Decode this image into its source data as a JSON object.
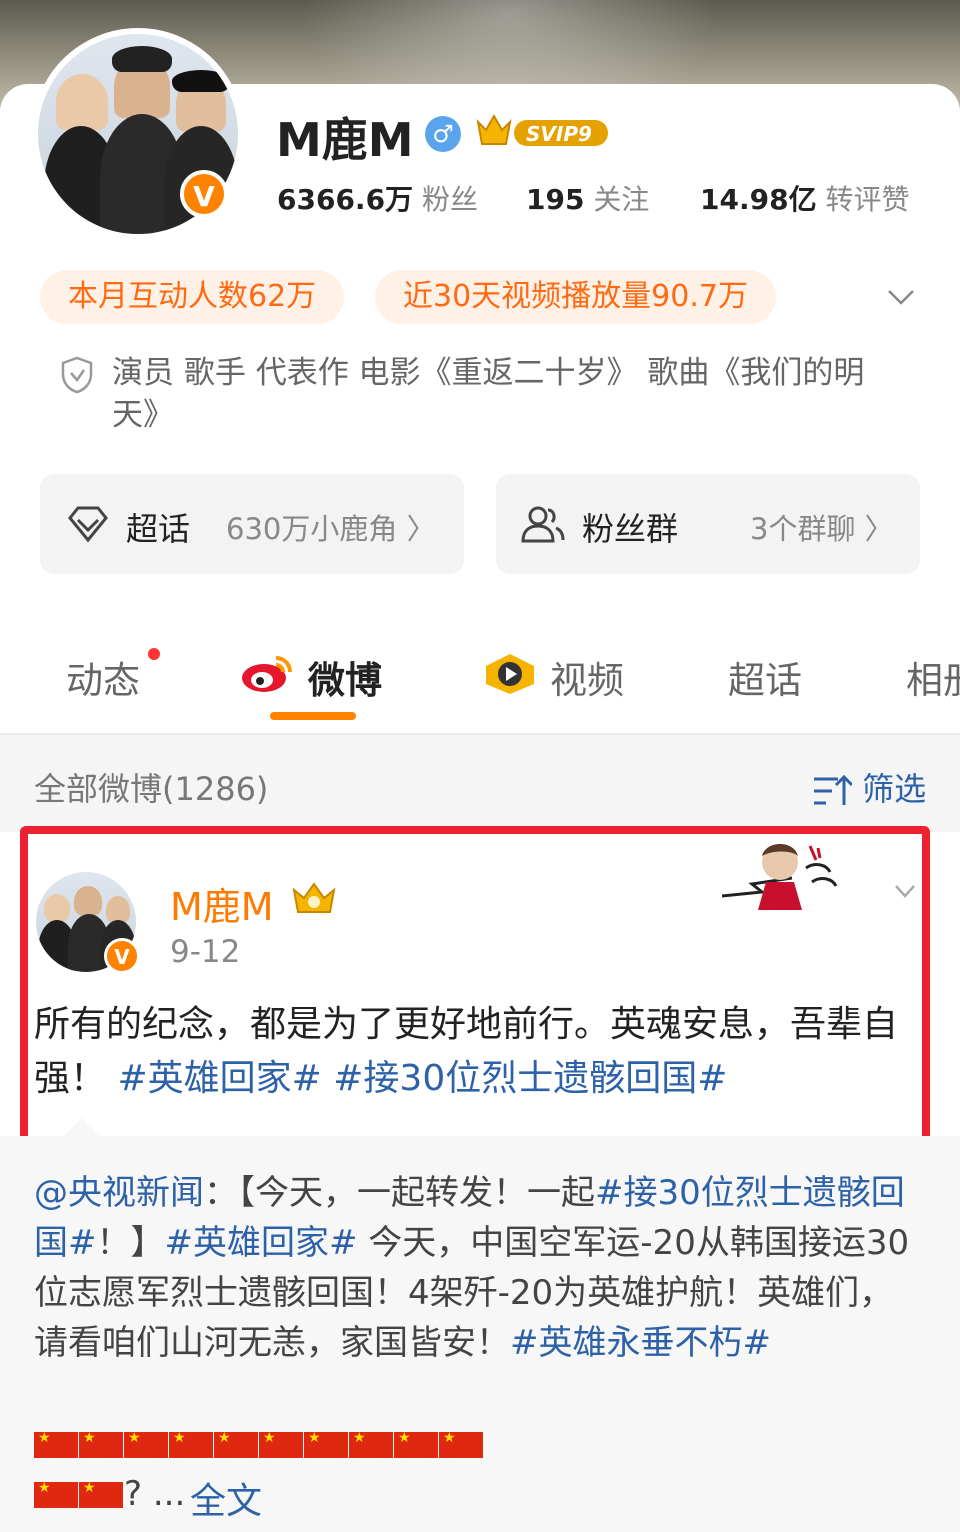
{
  "profile": {
    "name": "M鹿M",
    "gender_icon": "♂",
    "vip_badge": "SVIP9",
    "verified_badge": "V",
    "stats": {
      "fans_value": "6366.6万",
      "fans_label": "粉丝",
      "following_value": "195",
      "following_label": "关注",
      "interactions_value": "14.98亿",
      "interactions_label": "转评赞"
    },
    "pills": [
      "本月互动人数62万",
      "近30天视频播放量90.7万"
    ],
    "bio": "演员 歌手 代表作 电影《重返二十岁》 歌曲《我们的明天》"
  },
  "cards": {
    "supertopic": {
      "label": "超话",
      "value": "630万小鹿角 〉"
    },
    "fangroup": {
      "label": "粉丝群",
      "value": "3个群聊 〉"
    }
  },
  "tabs": [
    "动态",
    "微博",
    "视频",
    "超话",
    "相册"
  ],
  "feed": {
    "all_label": "全部微博(1286)",
    "filter_label": "筛选"
  },
  "post": {
    "author": "M鹿M",
    "date": "9-12",
    "text_plain": "所有的纪念，都是为了更好地前行。英魂安息，吾辈自强！",
    "topic1": "#英雄回家#",
    "topic2": "#接30位烈士遗骸回国#",
    "repost": {
      "mention": "@央视新闻",
      "part1": "：【今天，一起转发！一起",
      "topic_a": "#接30位烈士遗骸回国#",
      "part2": "！】",
      "topic_b": "#英雄回家#",
      "part3": " 今天，中国空军运-20从韩国接运30位志愿军烈士遗骸回国！4架歼-20为英雄护航！英雄们，请看咱们山河无恙，家国皆安！",
      "topic_c": "#英雄永垂不朽#",
      "flags_row1": 10,
      "flags_row2": 2,
      "more": "? ...",
      "full_text": "全文"
    }
  },
  "colors": {
    "accent": "#ff8200",
    "link": "#2d62a8",
    "highlight_border": "#ee2130"
  }
}
